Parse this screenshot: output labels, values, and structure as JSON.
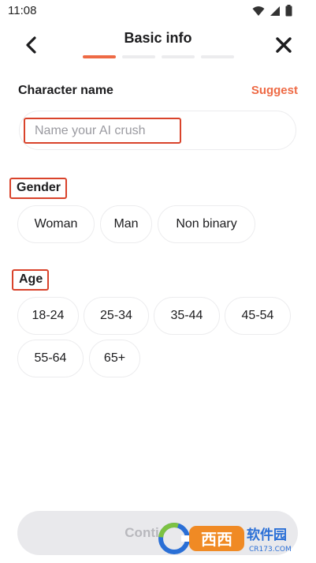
{
  "status_bar": {
    "time": "11:08",
    "icons": [
      "wifi-icon",
      "signal-icon",
      "battery-icon"
    ]
  },
  "header": {
    "title": "Basic info",
    "total_steps": 4,
    "current_step": 1
  },
  "character_name": {
    "label": "Character name",
    "suggest_label": "Suggest",
    "input_value": "",
    "placeholder": "Name your AI crush"
  },
  "gender": {
    "label": "Gender",
    "options": [
      "Woman",
      "Man",
      "Non binary"
    ]
  },
  "age": {
    "label": "Age",
    "options": [
      "18-24",
      "25-34",
      "35-44",
      "45-54",
      "55-64",
      "65+"
    ]
  },
  "continue_label": "Conti",
  "watermark": {
    "text": "西西软件园",
    "sub": "CR173.COM"
  },
  "colors": {
    "accent": "#ee6a45",
    "annotation_red": "#d9432b",
    "pill_border": "#ececee",
    "disabled_bg": "#e9e9ec"
  }
}
